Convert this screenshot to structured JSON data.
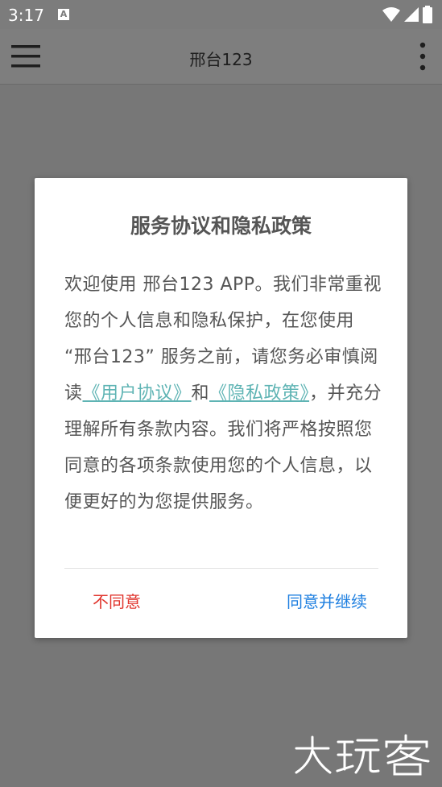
{
  "status_bar": {
    "time": "3:17",
    "notification_icon": "A"
  },
  "app_bar": {
    "title": "邢台123"
  },
  "dialog": {
    "title": "服务协议和隐私政策",
    "body_before_links": "欢迎使用 邢台123 APP。我们非常重视您的个人信息和隐私保护，在您使用 “邢台123” 服务之前，请您务必审慎阅读",
    "link_user_agreement": "《用户协议》",
    "and_text": "和",
    "link_privacy_policy": "《隐私政策》",
    "body_after_links": "，并充分理解所有条款内容。我们将严格按照您同意的各项条款使用您的个人信息，以便更好的为您提供服务。",
    "disagree_label": "不同意",
    "agree_label": "同意并继续"
  },
  "colors": {
    "link": "#5fb4b4",
    "disagree": "#e0342c",
    "agree": "#1e7fe0"
  }
}
